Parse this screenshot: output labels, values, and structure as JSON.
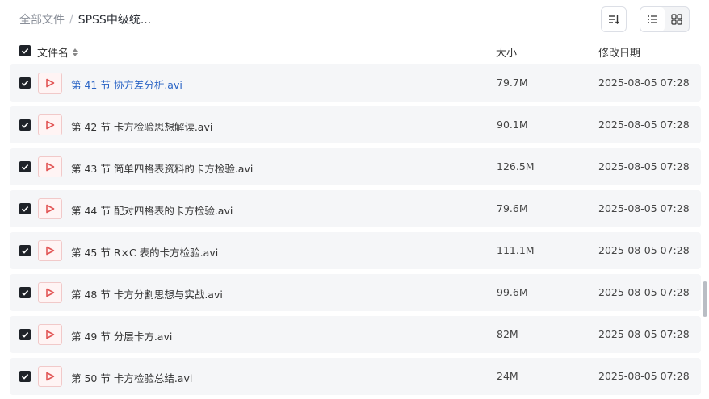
{
  "breadcrumb": {
    "root": "全部文件",
    "separator": "/",
    "current": "SPSS中级统..."
  },
  "toolbar": {
    "sort_icon": "sort-list-icon",
    "list_view_icon": "list-view-icon",
    "grid_view_icon": "grid-view-icon",
    "active_view": "list"
  },
  "columns": {
    "name": "文件名",
    "size": "大小",
    "modified": "修改日期"
  },
  "files": [
    {
      "name": "第 41 节 协方差分析.avi",
      "size": "79.7M",
      "modified": "2025-08-05 07:28",
      "checked": true,
      "hovered": true
    },
    {
      "name": "第 42 节 卡方检验思想解读.avi",
      "size": "90.1M",
      "modified": "2025-08-05 07:28",
      "checked": true
    },
    {
      "name": "第 43 节 简单四格表资料的卡方检验.avi",
      "size": "126.5M",
      "modified": "2025-08-05 07:28",
      "checked": true
    },
    {
      "name": "第 44 节 配对四格表的卡方检验.avi",
      "size": "79.6M",
      "modified": "2025-08-05 07:28",
      "checked": true
    },
    {
      "name": "第 45 节 R×C 表的卡方检验.avi",
      "size": "111.1M",
      "modified": "2025-08-05 07:28",
      "checked": true
    },
    {
      "name": "第 48 节 卡方分割思想与实战.avi",
      "size": "99.6M",
      "modified": "2025-08-05 07:28",
      "checked": true
    },
    {
      "name": "第 49 节 分层卡方.avi",
      "size": "82M",
      "modified": "2025-08-05 07:28",
      "checked": true
    },
    {
      "name": "第 50 节 卡方检验总结.avi",
      "size": "24M",
      "modified": "2025-08-05 07:28",
      "checked": true
    }
  ],
  "colors": {
    "link": "#2a64c5",
    "row_bg": "#f5f6f8",
    "checkbox": "#1f2329",
    "video_icon": "#e25555"
  }
}
